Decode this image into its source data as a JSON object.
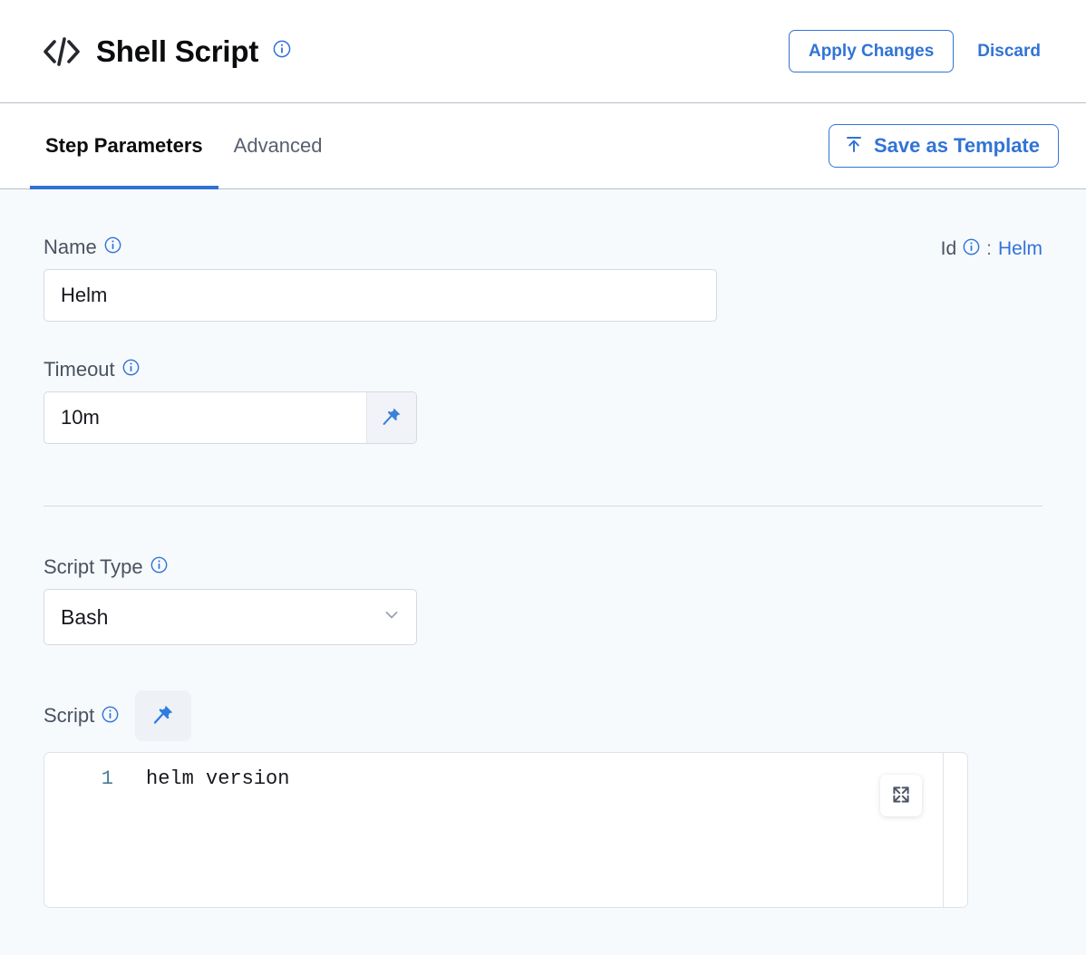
{
  "header": {
    "icon": "code-brackets-icon",
    "title": "Shell Script",
    "info_icon": "info-icon",
    "apply_label": "Apply Changes",
    "discard_label": "Discard"
  },
  "tabs": {
    "items": [
      {
        "label": "Step Parameters",
        "active": true
      },
      {
        "label": "Advanced",
        "active": false
      }
    ],
    "save_template_label": "Save as Template",
    "save_template_icon": "upload-icon"
  },
  "form": {
    "name": {
      "label": "Name",
      "value": "Helm",
      "info_icon": "info-icon"
    },
    "id": {
      "label": "Id",
      "separator": ":",
      "value": "Helm",
      "info_icon": "info-icon"
    },
    "timeout": {
      "label": "Timeout",
      "value": "10m",
      "info_icon": "info-icon",
      "pin_icon": "pin-icon"
    },
    "script_type": {
      "label": "Script Type",
      "value": "Bash",
      "info_icon": "info-icon",
      "chevron_icon": "chevron-down-icon"
    },
    "script": {
      "label": "Script",
      "info_icon": "info-icon",
      "pin_icon": "pin-icon",
      "expand_icon": "expand-icon",
      "line_number": "1",
      "code": "helm version"
    }
  },
  "colors": {
    "accent_blue": "#3273d6",
    "tab_underline": "#2f72d4",
    "content_bg": "#f6fafd",
    "label_gray": "#4a5260",
    "gutter_blue": "#4a7a95"
  }
}
